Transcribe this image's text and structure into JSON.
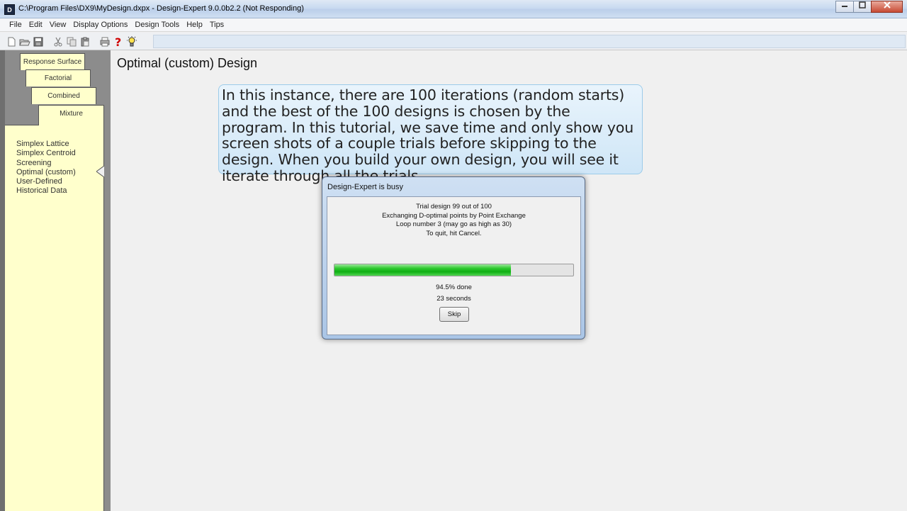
{
  "window": {
    "title": "C:\\Program Files\\DX9\\MyDesign.dxpx - Design-Expert 9.0.0b2.2 (Not Responding)",
    "icon_letter": "D",
    "icon": "design-expert-app-icon"
  },
  "menubar": {
    "items": [
      "File",
      "Edit",
      "View",
      "Display Options",
      "Design Tools",
      "Help",
      "Tips"
    ]
  },
  "toolbar": {
    "icons": [
      "new-file-icon",
      "open-folder-icon",
      "save-icon",
      "cut-icon",
      "copy-icon",
      "paste-icon",
      "print-icon",
      "help-icon",
      "tip-lightbulb-icon"
    ]
  },
  "left_panel": {
    "tabs": [
      "Response Surface",
      "Factorial",
      "Combined",
      "Mixture"
    ],
    "mixture_items": [
      "Simplex Lattice",
      "Simplex Centroid",
      "Screening",
      "Optimal (custom)",
      "User-Defined",
      "Historical Data"
    ]
  },
  "main": {
    "title": "Optimal (custom) Design",
    "callout": "In this instance, there are 100 iterations (random starts) and the best of the 100 designs is chosen by the program.  In this tutorial, we save time and only show you screen shots of a couple trials before skipping to the design.  When you build your own design, you will see it iterate through all the trials."
  },
  "dialog": {
    "title": "Design-Expert is busy",
    "line1": "Trial design 99 out of 100",
    "line2": "Exchanging D-optimal points by Point Exchange",
    "line3": "Loop number 3 (may go as high as 30)",
    "line4": "To quit, hit Cancel.",
    "progress_fraction": 0.74,
    "percent_label": "94.5% done",
    "time_label": "23 seconds",
    "skip_label": "Skip"
  },
  "colors": {
    "panel_yellow": "#ffffcc",
    "progress_green": "#0fae13",
    "callout_blue": "#cfe6f7"
  }
}
